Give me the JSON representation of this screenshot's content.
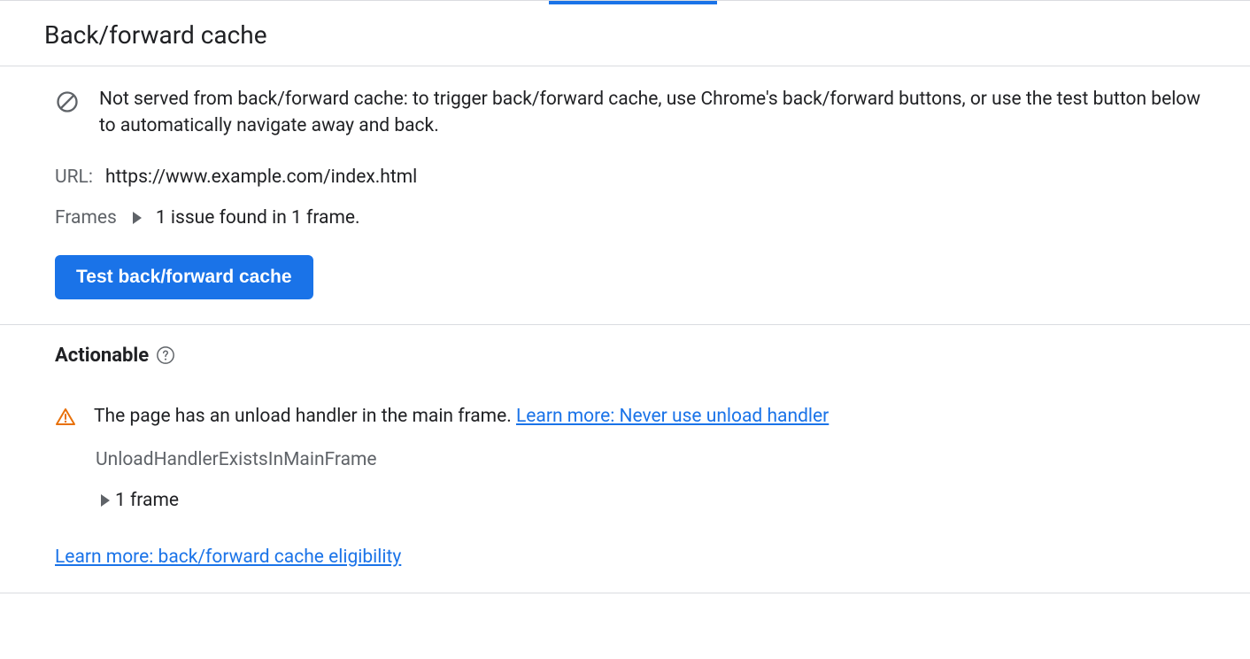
{
  "header": {
    "title": "Back/forward cache"
  },
  "main": {
    "info_text": "Not served from back/forward cache: to trigger back/forward cache, use Chrome's back/forward buttons, or use the test button below to automatically navigate away and back.",
    "url_label": "URL:",
    "url_value": "https://www.example.com/index.html",
    "frames_label": "Frames",
    "frames_value": "1 issue found in 1 frame.",
    "test_button_label": "Test back/forward cache"
  },
  "actionable": {
    "heading": "Actionable",
    "issue_text": "The page has an unload handler in the main frame. ",
    "issue_link": "Learn more: Never use unload handler",
    "reason": "UnloadHandlerExistsInMainFrame",
    "frame_count": "1 frame",
    "bottom_link": "Learn more: back/forward cache eligibility"
  }
}
